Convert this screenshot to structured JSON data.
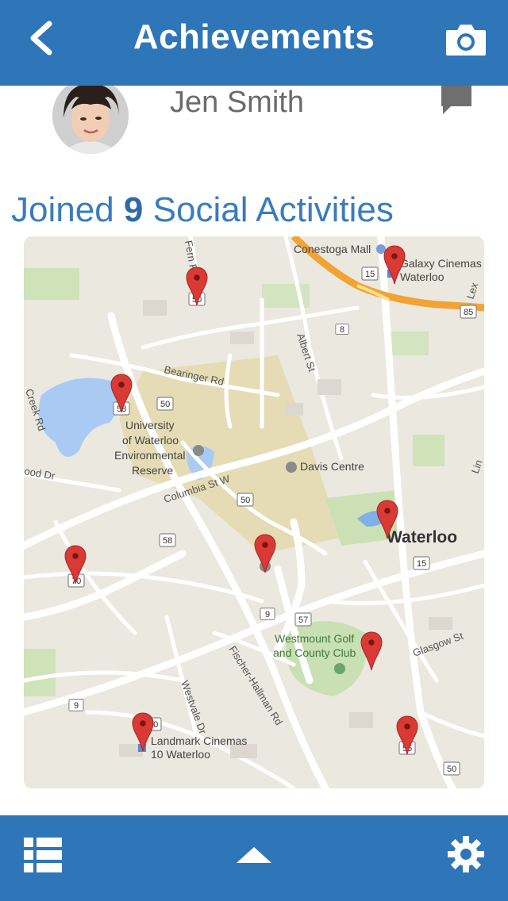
{
  "header": {
    "title": "Achievements"
  },
  "profile": {
    "name": "Jen Smith"
  },
  "achievement": {
    "prefix": "Joined",
    "count": "9",
    "suffix": "Social Activities"
  },
  "map": {
    "places": {
      "conestoga": "Conestoga Mall",
      "galaxy_1": "Galaxy Cinemas",
      "galaxy_2": "Waterloo",
      "uw_1": "University",
      "uw_2": "of Waterloo",
      "uw_3": "Environmental",
      "uw_4": "Reserve",
      "davis": "Davis Centre",
      "waterloo": "Waterloo",
      "westmount_1": "Westmount Golf",
      "westmount_2": "and County Club",
      "landmark_1": "Landmark Cinemas",
      "landmark_2": "10 Waterloo"
    },
    "roads": {
      "fern": "Fern Rd",
      "bearinger": "Bearinger Rd",
      "albert": "Albert St",
      "columbia": "Columbia St W",
      "creek": "Creek Rd",
      "wood": "ood Dr",
      "fischer": "Fischer-Hallman Rd",
      "westvale": "Westvale Dr",
      "glasgow": "Glasgow St",
      "lex": "Lex",
      "lin": "Lin"
    },
    "shields": {
      "s15": "15",
      "s85": "85",
      "s8": "8",
      "s50a": "50",
      "s58a": "58",
      "s50b": "50",
      "s50c": "50",
      "s58b": "58",
      "s70": "70",
      "s15b": "15",
      "s9": "9",
      "s57": "57",
      "s9b": "9",
      "s70b": "70",
      "s55": "55",
      "s50d": "50"
    },
    "pin_count": 9
  },
  "colors": {
    "brand": "#2f76b9",
    "accent_text": "#3a7cbd",
    "pin": "#d93a36"
  }
}
